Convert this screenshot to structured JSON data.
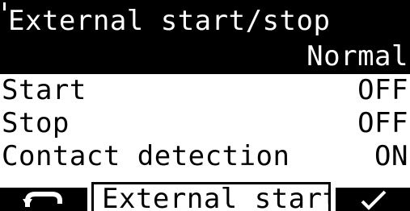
{
  "header": {
    "title": "External start/stop",
    "mode": "Normal"
  },
  "rows": [
    {
      "label": "Start",
      "value": "OFF"
    },
    {
      "label": "Stop",
      "value": "OFF"
    },
    {
      "label": "Contact detection",
      "value": "ON"
    }
  ],
  "softkeys": {
    "back_icon": "back-arrow-icon",
    "center_label": "External start/",
    "ok_icon": "checkmark-icon"
  },
  "colors": {
    "background": "#ffffff",
    "foreground": "#000000"
  }
}
